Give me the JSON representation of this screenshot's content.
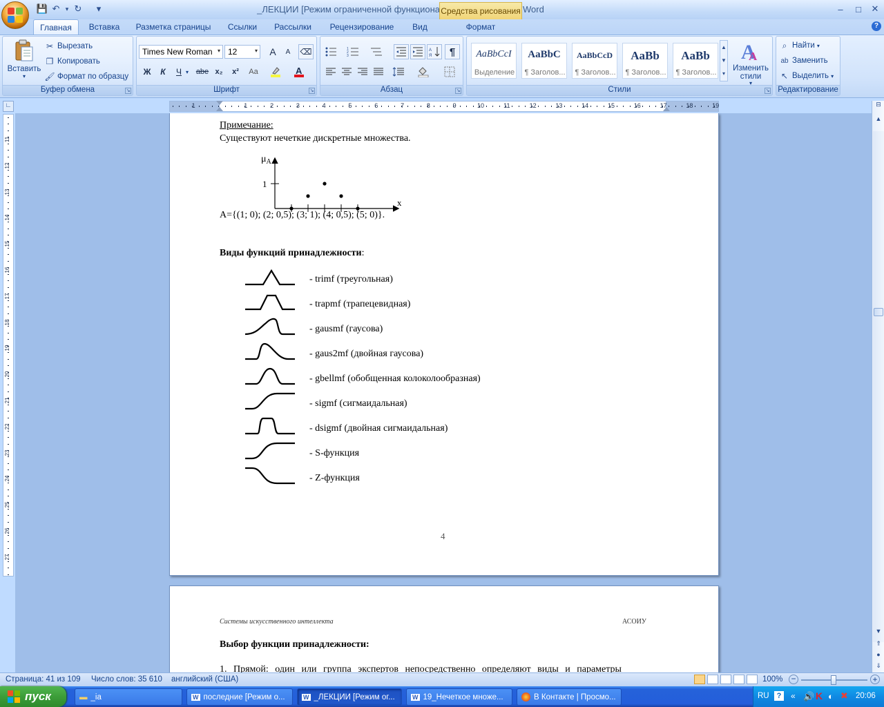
{
  "window": {
    "title": "_ЛЕКЦИИ [Режим ограниченной функциональности] - Microsoft Word",
    "context_tab": "Средства рисования",
    "minimize": "–",
    "maximize": "□",
    "close": "✕"
  },
  "quick_access": {
    "save": "💾",
    "undo": "↶",
    "redo": "↻",
    "more": "▾"
  },
  "tabs": [
    {
      "label": "Главная"
    },
    {
      "label": "Вставка"
    },
    {
      "label": "Разметка страницы"
    },
    {
      "label": "Ссылки"
    },
    {
      "label": "Рассылки"
    },
    {
      "label": "Рецензирование"
    },
    {
      "label": "Вид"
    },
    {
      "label": "Формат"
    }
  ],
  "help": "?",
  "ribbon": {
    "clipboard": {
      "label": "Буфер обмена",
      "paste": "Вставить",
      "cut": "Вырезать",
      "copy": "Копировать",
      "format_painter": "Формат по образцу"
    },
    "font": {
      "label": "Шрифт",
      "font_name": "Times New Roman",
      "font_size": "12",
      "bold": "Ж",
      "italic": "К",
      "underline": "Ч",
      "strike": "abe",
      "subscript": "x₂",
      "superscript": "x²",
      "change_case": "Aa",
      "grow": "A",
      "shrink": "A"
    },
    "paragraph": {
      "label": "Абзац",
      "pilcrow": "¶"
    },
    "styles": {
      "label": "Стили",
      "tiles": [
        {
          "sample": "AaBbCcI",
          "name": "Выделение"
        },
        {
          "sample": "AaBbC",
          "name": "¶ Заголов..."
        },
        {
          "sample": "AaBbCcD",
          "name": "¶ Заголов..."
        },
        {
          "sample": "AaBb",
          "name": "¶ Заголов..."
        },
        {
          "sample": "AaBb",
          "name": "¶ Заголов..."
        }
      ],
      "change_styles": "Изменить стили"
    },
    "editing": {
      "label": "Редактирование",
      "find": "Найти",
      "replace": "Заменить",
      "select": "Выделить"
    }
  },
  "ruler": {
    "h_ticks": [
      "1",
      "1",
      "2",
      "3",
      "4",
      "5",
      "6",
      "7",
      "8",
      "9",
      "10",
      "11",
      "12",
      "13",
      "14",
      "15",
      "16",
      "17",
      "18",
      "19"
    ],
    "v_ticks": [
      "11",
      "12",
      "13",
      "14",
      "15",
      "16",
      "17",
      "18",
      "19",
      "20",
      "21",
      "22",
      "23",
      "24",
      "25",
      "26",
      "27"
    ]
  },
  "page1": {
    "note_title": "Примечание:",
    "note_text": "Существуют нечеткие дискретные множества.",
    "plot": {
      "mu": "μ",
      "sub": "A",
      "one": "1",
      "x": "x"
    },
    "set_text": "A={(1; 0); (2; 0,5); (3; 1); (4; 0,5); (5; 0)}.",
    "heading": "Виды функций принадлежности",
    "heading_colon": ":",
    "functions": [
      {
        "label": "- trimf (треугольная)"
      },
      {
        "label": "- trapmf (трапецевидная)"
      },
      {
        "label": "- gausmf (гаусова)"
      },
      {
        "label": "- gaus2mf (двойная гаусова)"
      },
      {
        "label": "- gbellmf (обобщенная колоколообразная)"
      },
      {
        "label": "- sigmf (сигмаидальная)"
      },
      {
        "label": "- dsigmf (двойная сигмаидальная)"
      },
      {
        "label": "- S-функция"
      },
      {
        "label": "- Z-функция"
      }
    ],
    "page_number": "4"
  },
  "page2": {
    "header_left": "Системы искусственного интеллекта",
    "header_right": "АСОИУ",
    "heading": "Выбор функции принадлежности:",
    "para": "1. Прямой: один или группа экспертов непосредственно определяют виды и параметры"
  },
  "status": {
    "page": "Страница: 41 из 109",
    "words": "Число слов: 35 610",
    "lang": "английский (США)",
    "zoom": "100%"
  },
  "taskbar": {
    "start": "пуск",
    "tasks": [
      {
        "label": "_ia"
      },
      {
        "label": "последние [Режим о..."
      },
      {
        "label": "_ЛЕКЦИИ [Режим ог..."
      },
      {
        "label": "19_Нечеткое множе..."
      },
      {
        "label": "В Контакте | Просмо..."
      }
    ],
    "lang": "RU",
    "clock": "20:06"
  }
}
